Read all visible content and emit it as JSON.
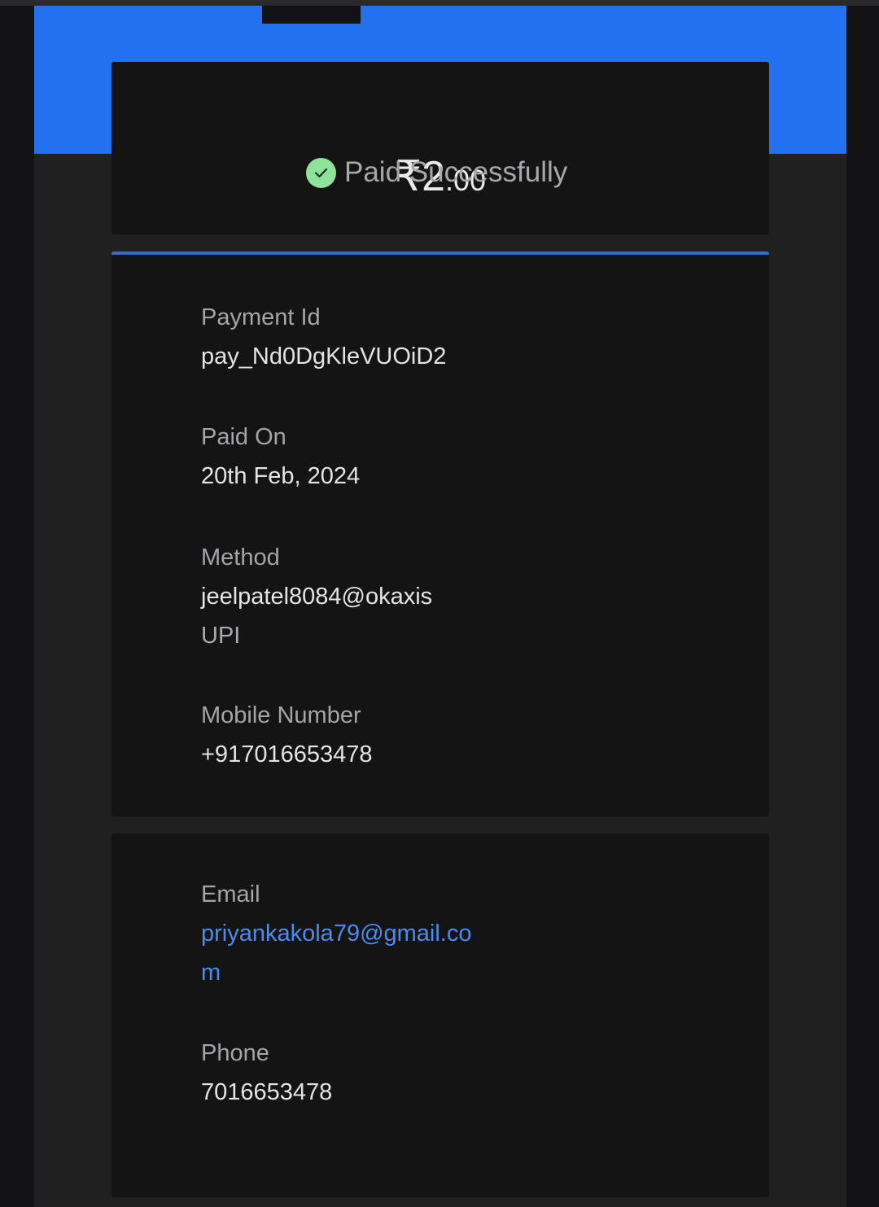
{
  "payment": {
    "currency_symbol": "₹",
    "amount_major": "2",
    "amount_minor": ".00",
    "status": "Paid Successfully"
  },
  "details": {
    "payment_id_label": "Payment Id",
    "payment_id": "pay_Nd0DgKleVUOiD2",
    "paid_on_label": "Paid On",
    "paid_on": "20th Feb, 2024",
    "method_label": "Method",
    "method_vpa": "jeelpatel8084@okaxis",
    "method_type": "UPI",
    "mobile_label": "Mobile Number",
    "mobile": "+917016653478"
  },
  "contact": {
    "email_label": "Email",
    "email": "priyankakola79@gmail.com",
    "phone_label": "Phone",
    "phone": "7016653478"
  },
  "colors": {
    "header_blue": "#2371ee",
    "success_green": "#8fe29a",
    "link_blue": "#4c8bf0",
    "card_bg": "#141414",
    "page_bg": "#202020"
  },
  "icons": {
    "status_icon": "check-circle-icon"
  }
}
